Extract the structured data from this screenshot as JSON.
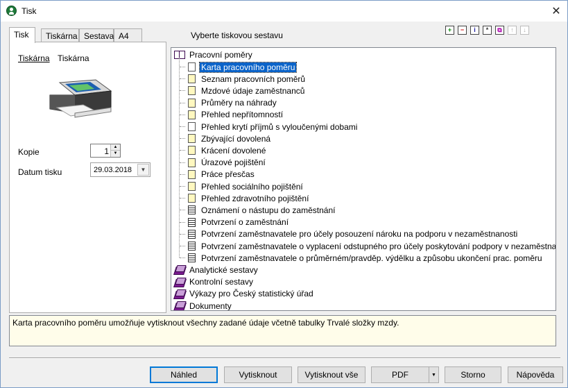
{
  "window": {
    "title": "Tisk",
    "close_glyph": "✕"
  },
  "tabs": [
    {
      "label": "Tisk",
      "active": true
    },
    {
      "label": "Tiskárna",
      "active": false
    },
    {
      "label": "Sestava",
      "active": false
    },
    {
      "label": "A4",
      "active": false
    }
  ],
  "left_panel": {
    "printer_label": "Tiskárna",
    "printer_name": "Tiskárna",
    "copies_label": "Kopie",
    "copies_value": "1",
    "date_label": "Datum tisku",
    "date_value": "29.03.2018"
  },
  "report_header": "Vyberte tiskovou sestavu",
  "toolbar": {
    "add": "+",
    "remove": "−",
    "info": "i",
    "star": "*",
    "copy": "⧉",
    "up": "↑",
    "down": "↓"
  },
  "tree": {
    "root": "Pracovní poměry",
    "children": [
      {
        "label": "Karta pracovního poměru",
        "icon": "doc-white",
        "selected": true
      },
      {
        "label": "Seznam pracovních poměrů",
        "icon": "doc-yellow"
      },
      {
        "label": "Mzdové údaje zaměstnanců",
        "icon": "doc-yellow"
      },
      {
        "label": "Průměry na náhrady",
        "icon": "doc-yellow"
      },
      {
        "label": "Přehled nepřítomností",
        "icon": "doc-yellow"
      },
      {
        "label": "Přehled krytí příjmů s vyloučenými dobami",
        "icon": "doc-white"
      },
      {
        "label": "Zbývající dovolená",
        "icon": "doc-yellow"
      },
      {
        "label": "Krácení dovolené",
        "icon": "doc-yellow"
      },
      {
        "label": "Úrazové pojištění",
        "icon": "doc-yellow"
      },
      {
        "label": "Práce přesčas",
        "icon": "doc-yellow"
      },
      {
        "label": "Přehled sociálního pojištění",
        "icon": "doc-yellow"
      },
      {
        "label": "Přehled zdravotního pojištění",
        "icon": "doc-yellow"
      },
      {
        "label": "Oznámení o nástupu do zaměstnání",
        "icon": "doc-lined"
      },
      {
        "label": "Potvrzení o zaměstnání",
        "icon": "doc-lined"
      },
      {
        "label": "Potvrzení zaměstnavatele pro účely posouzení nároku na podporu v nezaměstnanosti",
        "icon": "doc-lined"
      },
      {
        "label": "Potvrzení zaměstnavatele o vyplacení odstupného pro účely poskytování podpory v nezaměstnanosti",
        "icon": "doc-lined"
      },
      {
        "label": "Potvrzení zaměstnavatele o průměrném/pravděp. výdělku a způsobu ukončení prac. poměru",
        "icon": "doc-lined"
      }
    ],
    "groups": [
      "Analytické sestavy",
      "Kontrolní sestavy",
      "Výkazy pro Český statistický úřad",
      "Dokumenty"
    ]
  },
  "description": "Karta pracovního poměru umožňuje vytisknout všechny zadané údaje včetně tabulky Trvalé složky mzdy.",
  "buttons": {
    "preview": "Náhled",
    "print": "Vytisknout",
    "print_all": "Vytisknout vše",
    "pdf": "PDF",
    "cancel": "Storno",
    "help": "Nápověda"
  }
}
